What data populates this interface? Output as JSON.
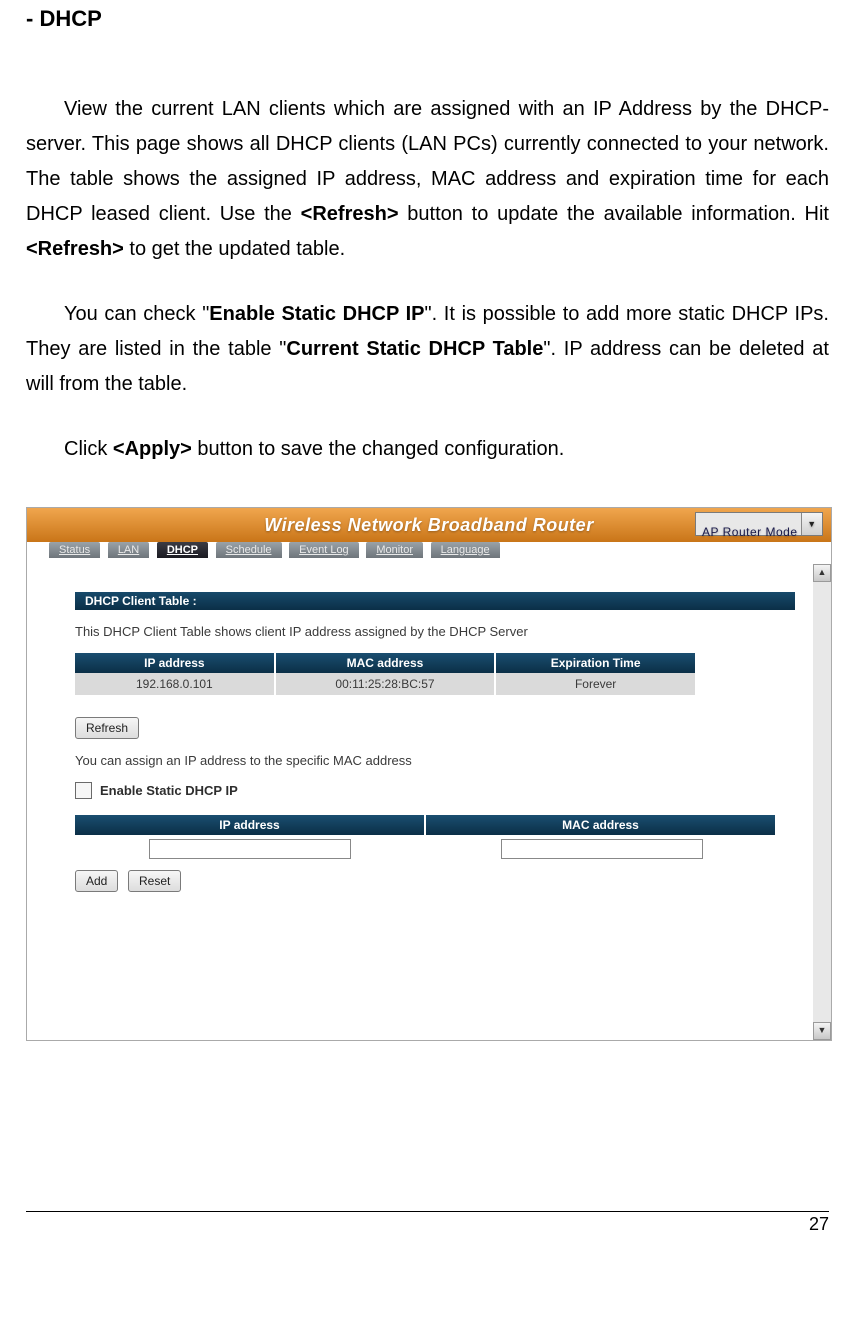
{
  "doc": {
    "heading": "- DHCP",
    "p1_a": "View the current LAN clients which are assigned with an IP Address by the DHCP-server. This page shows all DHCP clients (LAN PCs) currently connected to your network. The table shows the assigned IP address, MAC address and expiration time for each DHCP leased client. Use the ",
    "p1_b1": "<Refresh>",
    "p1_c": " button to update the available information. Hit ",
    "p1_b2": "<Refresh>",
    "p1_d": " to get the updated table.",
    "p2_a": "You can check \"",
    "p2_b1": "Enable Static DHCP IP",
    "p2_c": "\". It is possible to add more static DHCP IPs. They are listed in the table \"",
    "p2_b2": "Current Static DHCP Table",
    "p2_d": "\". IP address can be deleted at will from the table.",
    "p3_a": "Click ",
    "p3_b": "<Apply>",
    "p3_c": " button to save the changed configuration.",
    "page_number": "27"
  },
  "router": {
    "title": "Wireless Network Broadband Router",
    "mode": "AP Router Mode",
    "tabs": [
      "Status",
      "LAN",
      "DHCP",
      "Schedule",
      "Event Log",
      "Monitor",
      "Language"
    ],
    "active_tab": "DHCP",
    "section_title": "DHCP Client Table :",
    "section_desc": "This DHCP Client Table shows client IP address assigned by the DHCP Server",
    "client_headers": {
      "ip": "IP address",
      "mac": "MAC address",
      "exp": "Expiration Time"
    },
    "clients": [
      {
        "ip": "192.168.0.101",
        "mac": "00:11:25:28:BC:57",
        "exp": "Forever"
      }
    ],
    "refresh_label": "Refresh",
    "assign_desc": "You can assign an IP address to the specific MAC address",
    "enable_static_label": "Enable Static DHCP IP",
    "static_headers": {
      "ip": "IP address",
      "mac": "MAC address"
    },
    "add_label": "Add",
    "reset_label": "Reset"
  }
}
